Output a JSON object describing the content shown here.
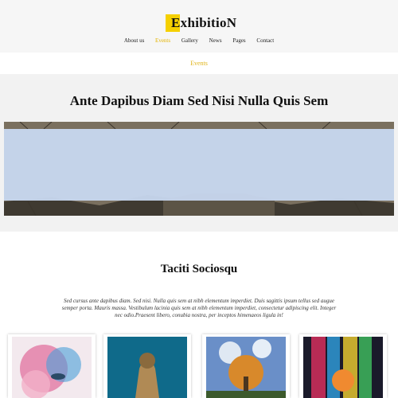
{
  "header": {
    "logo_text": "ExhibitioN",
    "nav": [
      {
        "label": "About us",
        "active": false
      },
      {
        "label": "Events",
        "active": true
      },
      {
        "label": "Gallery",
        "active": false
      },
      {
        "label": "News",
        "active": false
      },
      {
        "label": "Pages",
        "active": false
      },
      {
        "label": "Contact",
        "active": false
      }
    ]
  },
  "breadcrumb": {
    "current": "Events"
  },
  "hero": {
    "title": "Ante Dapibus Diam Sed Nisi Nulla Quis Sem"
  },
  "section": {
    "title": "Taciti Sociosqu",
    "text": "Sed cursus ante dapibus diam. Sed nisi. Nulla quis sem at nibh elementum imperdiet. Duis sagittis ipsum tellus sed augue semper porta. Mauris massa. Vestibulum lacinia quis sem at nibh elementum imperdiet, consectetur adipiscing elit. Integer nec odio.Praesent libero, conubia nostra, per inceptos himenaeos ligula in!"
  },
  "colors": {
    "accent": "#f5d000",
    "active_nav": "#e4b400",
    "banner_overlay": "#c8d8f0"
  }
}
